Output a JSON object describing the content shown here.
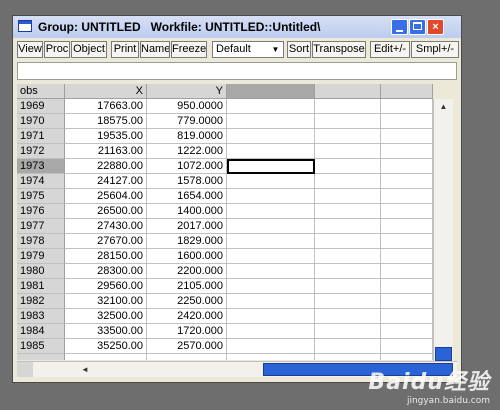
{
  "window": {
    "title": "Group: UNTITLED   Workfile: UNTITLED::Untitled\\",
    "buttons": {
      "minimize": "",
      "maximize": "",
      "close": "×"
    }
  },
  "toolbar": {
    "buttons": [
      "View",
      "Proc",
      "Object",
      "Print",
      "Name",
      "Freeze"
    ],
    "combo_value": "Default",
    "combo_arrow": "▼",
    "right_buttons": [
      "Sort",
      "Transpose",
      "Edit+/-",
      "Smpl+/-"
    ]
  },
  "grid": {
    "headers": [
      "obs",
      "X",
      "Y",
      "",
      "",
      ""
    ],
    "rows": [
      [
        "1969",
        "17663.00",
        "950.0000"
      ],
      [
        "1970",
        "18575.00",
        "779.0000"
      ],
      [
        "1971",
        "19535.00",
        "819.0000"
      ],
      [
        "1972",
        "21163.00",
        "1222.000"
      ],
      [
        "1973",
        "22880.00",
        "1072.000"
      ],
      [
        "1974",
        "24127.00",
        "1578.000"
      ],
      [
        "1975",
        "25604.00",
        "1654.000"
      ],
      [
        "1976",
        "26500.00",
        "1400.000"
      ],
      [
        "1977",
        "27430.00",
        "2017.000"
      ],
      [
        "1978",
        "27670.00",
        "1829.000"
      ],
      [
        "1979",
        "28150.00",
        "1600.000"
      ],
      [
        "1980",
        "28300.00",
        "2200.000"
      ],
      [
        "1981",
        "29560.00",
        "2105.000"
      ],
      [
        "1982",
        "32100.00",
        "2250.000"
      ],
      [
        "1983",
        "32500.00",
        "2420.000"
      ],
      [
        "1984",
        "33500.00",
        "1720.000"
      ],
      [
        "1985",
        "35250.00",
        "2570.000"
      ],
      [
        "",
        "",
        ""
      ]
    ],
    "selected_row": 4
  },
  "scrollbars": {
    "up_arrow": "▲",
    "left_arrow": "◄"
  },
  "watermark": {
    "logo": "Baidu经验",
    "url": "jingyan.baidu.com"
  }
}
